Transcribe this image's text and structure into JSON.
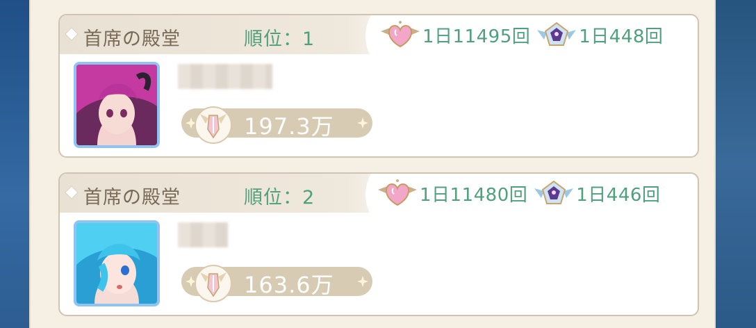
{
  "cards": [
    {
      "hall_title": "首席の殿堂",
      "rank": "順位：1",
      "likes_daily": "1日11495回",
      "honors_daily": "1日448回",
      "power": "197.3万",
      "avatar_hair": "#b8349a",
      "name_blur_width": 136
    },
    {
      "hall_title": "首席の殿堂",
      "rank": "順位：2",
      "likes_daily": "1日11480回",
      "honors_daily": "1日446回",
      "power": "163.6万",
      "avatar_hair": "#3ec3ea",
      "name_blur_width": 72
    }
  ],
  "colors": {
    "accent_green": "#4fa07c",
    "title_brown": "#7a6a58",
    "card_border": "#cfc4b2",
    "power_pill": "#d8cbb4"
  },
  "icons": [
    "heart-wing-icon",
    "crest-badge-icon",
    "power-medal-icon",
    "sparkle-icon"
  ]
}
